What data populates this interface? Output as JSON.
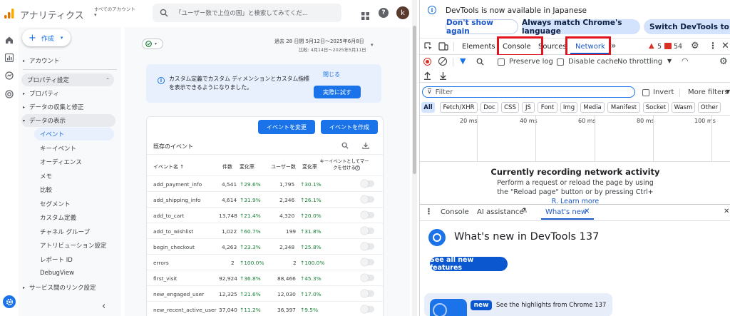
{
  "ga": {
    "brand": "アナリティクス",
    "account_label": "すべてのアカウント",
    "search_placeholder": "「ユーザー数で上位の国」と検索してみてくだ...",
    "avatar_initial": "k",
    "create_label": "作成",
    "nav": {
      "account": "アカウント",
      "property_settings": "プロパティ設定",
      "property": "プロパティ",
      "data_collection": "データの収集と修正",
      "data_display": "データの表示",
      "items": [
        "イベント",
        "キーイベント",
        "オーディエンス",
        "メモ",
        "比較",
        "セグメント",
        "カスタム定義",
        "チャネル グループ",
        "アトリビューション設定",
        "レポート ID",
        "DebugView"
      ],
      "service_links": "サービス間のリンク設定"
    },
    "date_range": "過去 28 日間  5月12日～2025年6月8日",
    "compare_range": "比較: 4月14日～2025年5月11日",
    "banner_text": "カスタム定義でカスタム ディメンションとカスタム指標を表示できるようになりました。",
    "banner_close": "閉じる",
    "banner_try": "実際に試す",
    "modify_event": "イベントを変更",
    "create_event": "イベントを作成",
    "table_title": "既存のイベント",
    "headers": {
      "name": "イベント名 ↑",
      "count": "件数",
      "change": "変化率",
      "users": "ユーザー数",
      "change2": "変化率",
      "key": "キーイベントとしてマークを付ける"
    },
    "rows": [
      {
        "name": "add_payment_info",
        "count": "4,541",
        "change": "29.6%",
        "users": "1,795",
        "change2": "30.1%"
      },
      {
        "name": "add_shipping_info",
        "count": "4,614",
        "change": "31.9%",
        "users": "2,346",
        "change2": "26.1%"
      },
      {
        "name": "add_to_cart",
        "count": "13,748",
        "change": "21.4%",
        "users": "4,320",
        "change2": "20.0%"
      },
      {
        "name": "add_to_wishlist",
        "count": "1,022",
        "change": "60.7%",
        "users": "199",
        "change2": "31.8%"
      },
      {
        "name": "begin_checkout",
        "count": "4,263",
        "change": "23.3%",
        "users": "2,348",
        "change2": "25.8%"
      },
      {
        "name": "errors",
        "count": "2",
        "change": "100.0%",
        "users": "2",
        "change2": "100.0%"
      },
      {
        "name": "first_visit",
        "count": "92,924",
        "change": "36.8%",
        "users": "88,466",
        "change2": "45.3%"
      },
      {
        "name": "new_engaged_user",
        "count": "12,325",
        "change": "21.6%",
        "users": "12,030",
        "change2": "17.0%"
      },
      {
        "name": "new_recent_active_user",
        "count": "37,040",
        "change": "11.2%",
        "users": "36,397",
        "change2": "9.5%"
      }
    ]
  },
  "devtools": {
    "notice": "DevTools is now available in Japanese",
    "dont_show": "Don't show again",
    "match_lang": "Always match Chrome's language",
    "switch": "Switch DevTools to Japan",
    "tabs": {
      "elements": "Elements",
      "console": "Console",
      "sources": "Sources",
      "network": "Network"
    },
    "warn_count": "5",
    "err_count": "54",
    "preserve_log": "Preserve log",
    "disable_cache": "Disable cache",
    "throttling": "No throttling",
    "filter_placeholder": "Filter",
    "invert": "Invert",
    "more_filters": "More filters",
    "chips": [
      "All",
      "Fetch/XHR",
      "Doc",
      "CSS",
      "JS",
      "Font",
      "Img",
      "Media",
      "Manifest",
      "Socket",
      "Wasm",
      "Other"
    ],
    "ticks": [
      "20 ms",
      "40 ms",
      "60 ms",
      "80 ms",
      "100 ms"
    ],
    "recording_title": "Currently recording network activity",
    "recording_desc1": "Perform a request or reload the page by using",
    "recording_desc2": "the \"Reload page\" button or by pressing Ctrl+",
    "recording_desc3": "R. Learn more",
    "drawer_tabs": {
      "console": "Console",
      "ai": "AI assistance",
      "whats_new": "What's new"
    },
    "whats_new_title": "What's new in DevTools 137",
    "see_all": "See all new features",
    "new_badge": "new",
    "highlights": "See the highlights from Chrome 137"
  }
}
